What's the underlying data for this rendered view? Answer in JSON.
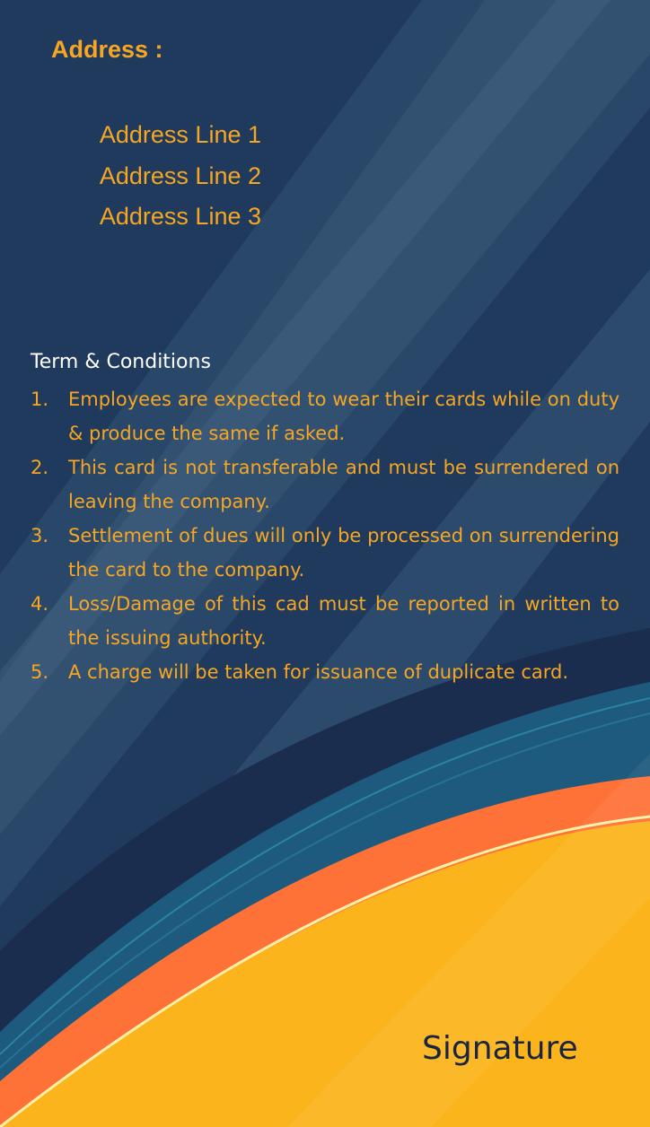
{
  "address": {
    "heading": "Address :",
    "lines": [
      "Address Line 1",
      "Address Line 2",
      "Address Line 3"
    ]
  },
  "terms": {
    "heading": "Term & Conditions",
    "items": [
      {
        "number": "1.",
        "text": "Employees are expected to wear their cards while on duty & produce the same if asked."
      },
      {
        "number": "2.",
        "text": "This card is not transferable and must be surrendered on leaving the company."
      },
      {
        "number": "3.",
        "text": "Settlement of dues will only be processed on surrendering the card to the company."
      },
      {
        "number": "4.",
        "text": "Loss/Damage of this cad must be reported in written to the issuing authority."
      },
      {
        "number": "5.",
        "text": "A charge will be taken for issuance of duplicate card."
      }
    ]
  },
  "signature": {
    "label": "Signature"
  },
  "colors": {
    "background": "#1f3a5c",
    "accent_text": "#f6a623",
    "heading_text": "#ffffff",
    "wave_yellow": "#fbb41c",
    "wave_orange": "#ff7237",
    "wave_teal": "#1e5a7e",
    "signature_text": "#1b2440"
  }
}
